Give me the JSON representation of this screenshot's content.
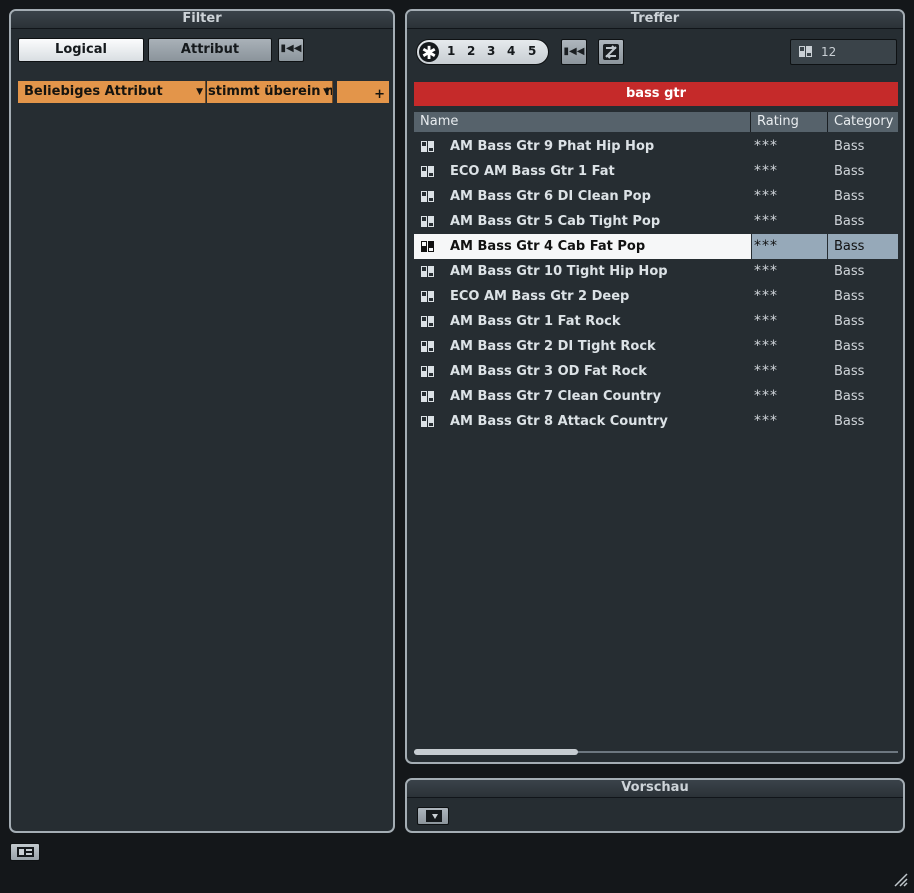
{
  "filter": {
    "title": "Filter",
    "logical_label": "Logical",
    "attribut_label": "Attribut",
    "rule": {
      "attribute": "Beliebiges Attribut",
      "operator": "stimmt überein mi"
    }
  },
  "treffer": {
    "title": "Treffer",
    "rating_filters": [
      "1",
      "2",
      "3",
      "4",
      "5"
    ],
    "result_count": "12",
    "search_text": "bass gtr",
    "columns": {
      "name": "Name",
      "rating": "Rating",
      "category": "Category"
    },
    "rows": [
      {
        "name": "AM Bass Gtr 9 Phat Hip Hop",
        "rating": "***",
        "category": "Bass"
      },
      {
        "name": "ECO AM Bass Gtr 1 Fat",
        "rating": "***",
        "category": "Bass"
      },
      {
        "name": "AM Bass Gtr 6 DI Clean Pop",
        "rating": "***",
        "category": "Bass"
      },
      {
        "name": "AM Bass Gtr 5 Cab Tight Pop",
        "rating": "***",
        "category": "Bass"
      },
      {
        "name": "AM Bass Gtr 4 Cab Fat Pop",
        "rating": "***",
        "category": "Bass",
        "selected": true
      },
      {
        "name": "AM Bass Gtr 10 Tight Hip Hop",
        "rating": "***",
        "category": "Bass"
      },
      {
        "name": "ECO AM Bass Gtr 2 Deep",
        "rating": "***",
        "category": "Bass"
      },
      {
        "name": "AM Bass Gtr 1 Fat Rock",
        "rating": "***",
        "category": "Bass"
      },
      {
        "name": "AM Bass Gtr 2 DI Tight Rock",
        "rating": "***",
        "category": "Bass"
      },
      {
        "name": "AM Bass Gtr 3 OD Fat Rock",
        "rating": "***",
        "category": "Bass"
      },
      {
        "name": "AM Bass Gtr 7 Clean Country",
        "rating": "***",
        "category": "Bass"
      },
      {
        "name": "AM Bass Gtr 8 Attack Country",
        "rating": "***",
        "category": "Bass"
      }
    ]
  },
  "vorschau": {
    "title": "Vorschau"
  },
  "colors": {
    "rule_orange": "#e3954a",
    "search_red": "#c52a2a",
    "selected_accent": "#96a9b9"
  }
}
